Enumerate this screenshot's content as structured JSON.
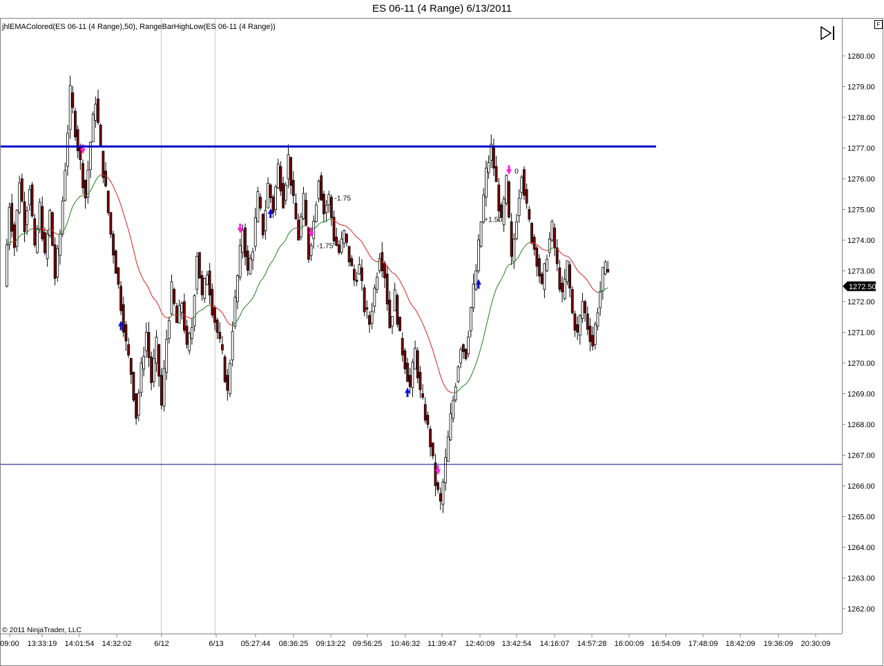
{
  "window": {
    "title": "ES 06-11 (4 Range)  6/13/2011",
    "indicator_label": "jhlEMAColored(ES 06-11 (4 Range),50), RangeBarHighLow(ES 06-11 (4 Range))",
    "copyright": "© 2011 NinjaTrader, LLC",
    "f_button": "F",
    "goto_end_icon": "goto-end-icon"
  },
  "colors": {
    "background": "#ffffff",
    "up_candle": "#ffffff",
    "down_candle": "#7a0000",
    "ema_up": "#2e8b2e",
    "ema_down": "#e03030",
    "high_line": "#0000c8",
    "low_line": "#000080",
    "signal_magenta": "#ff20e0",
    "signal_blue": "#1010d0",
    "price_marker": "#000000"
  },
  "chart_data": {
    "type": "candlestick",
    "ylim": [
      1261.5,
      1280.5
    ],
    "y_ticks": [
      "1280.00",
      "1279.00",
      "1278.00",
      "1277.00",
      "1276.00",
      "1275.00",
      "1274.00",
      "1273.00",
      "1272.00",
      "1271.00",
      "1270.00",
      "1269.00",
      "1268.00",
      "1267.00",
      "1266.00",
      "1265.00",
      "1264.00",
      "1263.00",
      "1262.00"
    ],
    "x_ticks": [
      "09:00",
      "13:33:19",
      "14:01:54",
      "14:32:02",
      "6/12",
      "6/13",
      "05:27:44",
      "08:36:25",
      "09:13:22",
      "09:56:25",
      "10:46:32",
      "11:39:47",
      "12:40:09",
      "13:42:54",
      "14:16:07",
      "14:57:28",
      "16:00:09",
      "16:54:09",
      "17:48:09",
      "18:42:09",
      "19:36:09",
      "20:30:09"
    ],
    "horizontal_lines": [
      {
        "price": 1277.05,
        "label": "range-high"
      },
      {
        "price": 1266.7,
        "label": "range-low"
      }
    ],
    "last_price_label": "1272.50",
    "last_price": 1272.5,
    "trade_labels": [
      "+1.50",
      "0",
      "-1.75",
      "-1.75"
    ],
    "path": [
      1272.5,
      1275.2,
      1273.8,
      1276.0,
      1274.5,
      1275.8,
      1273.6,
      1275.1,
      1273.4,
      1274.9,
      1272.8,
      1274.2,
      1276.4,
      1278.8,
      1277.6,
      1276.5,
      1275.4,
      1277.2,
      1278.6,
      1276.9,
      1275.6,
      1274.2,
      1273.1,
      1271.9,
      1270.6,
      1269.7,
      1268.3,
      1269.8,
      1271.0,
      1269.4,
      1270.6,
      1268.6,
      1270.8,
      1272.4,
      1271.3,
      1272.0,
      1270.4,
      1271.2,
      1273.6,
      1272.1,
      1273.0,
      1271.8,
      1271.0,
      1270.2,
      1269.0,
      1271.2,
      1272.8,
      1274.4,
      1272.9,
      1273.8,
      1275.4,
      1274.3,
      1275.8,
      1275.0,
      1276.4,
      1275.3,
      1276.7,
      1275.2,
      1274.1,
      1275.3,
      1273.5,
      1274.6,
      1276.1,
      1274.9,
      1275.4,
      1274.1,
      1273.6,
      1274.2,
      1273.4,
      1272.7,
      1273.1,
      1271.8,
      1271.3,
      1272.4,
      1273.6,
      1272.9,
      1271.2,
      1272.2,
      1270.8,
      1270.0,
      1269.2,
      1270.4,
      1269.0,
      1268.3,
      1267.4,
      1266.1,
      1265.4,
      1266.8,
      1268.2,
      1269.4,
      1270.6,
      1270.3,
      1271.8,
      1273.0,
      1274.6,
      1276.2,
      1277.0,
      1275.8,
      1274.5,
      1275.9,
      1273.3,
      1274.8,
      1276.3,
      1275.0,
      1274.1,
      1273.4,
      1272.4,
      1273.6,
      1274.4,
      1273.1,
      1272.1,
      1273.2,
      1271.6,
      1270.9,
      1272.0,
      1271.2,
      1270.6,
      1271.8,
      1272.9,
      1273.2
    ]
  }
}
